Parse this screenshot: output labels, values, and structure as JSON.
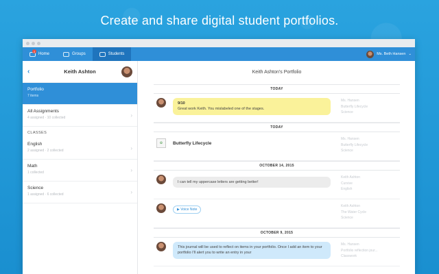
{
  "headline": "Create and share digital student portfolios.",
  "nav": {
    "items": [
      {
        "label": "Home",
        "badge": "2"
      },
      {
        "label": "Groups"
      },
      {
        "label": "Students"
      }
    ],
    "user": "Ms. Beth Hansen"
  },
  "sidebar": {
    "student": "Keith Ashton",
    "items": [
      {
        "label": "Portfolio",
        "sub": "7 items"
      },
      {
        "label": "All Assignments",
        "sub": "4 assigned · 10 collected"
      }
    ],
    "section_label": "CLASSES",
    "classes": [
      {
        "label": "English",
        "sub": "2 assigned · 2 collected"
      },
      {
        "label": "Math",
        "sub": "1 collected"
      },
      {
        "label": "Science",
        "sub": "1 assigned · 6 collected"
      }
    ]
  },
  "main": {
    "title": "Keith Ashton's Portfolio",
    "feed": {
      "d1": "TODAY",
      "e1": {
        "score": "9/10",
        "text": "Great work Keith. You mislabeled one of the stages.",
        "m1": "Ms. Hansen",
        "m2": "Butterfly Lifecycle",
        "m3": "Science"
      },
      "d2": "TODAY",
      "e2": {
        "title": "Butterfly Lifecycle",
        "m1": "Ms. Hansen",
        "m2": "Butterfly Lifecycle",
        "m3": "Science"
      },
      "d3": "OCTOBER 14, 2015",
      "e3": {
        "text": "I can tell my uppercase letters are getting better!",
        "m1": "Keith Ashton",
        "m2": "Cursive",
        "m3": "English"
      },
      "e4": {
        "voice": "▶ Voice Note",
        "m1": "Keith Ashton",
        "m2": "The Water Cycle",
        "m3": "Science"
      },
      "d4": "OCTOBER 9, 2015",
      "e5": {
        "text": "This journal will be used to reflect on items in your portfolio. Once I add an item to your portfolio I'll alert you to write an entry in your",
        "m1": "Ms. Hansen",
        "m2": "Portfolio reflection jour...",
        "m3": "Classwork"
      }
    }
  }
}
